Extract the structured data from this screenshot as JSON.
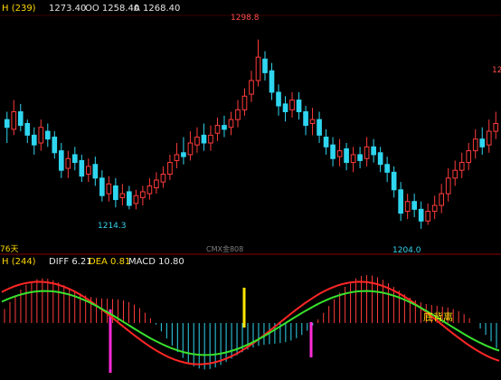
{
  "main_panel": {
    "header": {
      "title": "H (239)",
      "high_label": "1273.40",
      "open_label": "OO 1258.40",
      "avg_label": "A 1268.40"
    },
    "days_label": "76天",
    "watermark": "CMX金808",
    "price_annotations": [
      {
        "text": "1298.8",
        "color": "#ff4d4d"
      },
      {
        "text": "1214.3",
        "color": "#36d3ee"
      },
      {
        "text": "1204.0",
        "color": "#36d3ee"
      },
      {
        "text": "12",
        "color": "#ff4d4d"
      }
    ]
  },
  "macd_panel": {
    "header": {
      "title": "H (244)",
      "diff": "DIFF 6.21",
      "dea": "DEA 0.81",
      "macd": "MACD 10.80"
    },
    "annotation": "底背离"
  },
  "chart_data": {
    "type": "candlestick",
    "y_range": [
      1195,
      1310
    ],
    "candles": [
      [
        1258,
        1254,
        1262,
        1246
      ],
      [
        1253,
        1262,
        1268,
        1250
      ],
      [
        1262,
        1255,
        1266,
        1252
      ],
      [
        1256,
        1250,
        1258,
        1246
      ],
      [
        1250,
        1245,
        1254,
        1240
      ],
      [
        1246,
        1254,
        1258,
        1242
      ],
      [
        1252,
        1248,
        1256,
        1244
      ],
      [
        1249,
        1241,
        1252,
        1238
      ],
      [
        1242,
        1232,
        1246,
        1228
      ],
      [
        1233,
        1238,
        1242,
        1228
      ],
      [
        1240,
        1236,
        1244,
        1232
      ],
      [
        1237,
        1229,
        1240,
        1226
      ],
      [
        1230,
        1234,
        1238,
        1226
      ],
      [
        1235,
        1228,
        1239,
        1224
      ],
      [
        1228,
        1219,
        1232,
        1216
      ],
      [
        1220,
        1225,
        1229,
        1216
      ],
      [
        1224,
        1217,
        1228,
        1213
      ],
      [
        1218,
        1220,
        1225,
        1214
      ],
      [
        1221,
        1214,
        1224,
        1212
      ],
      [
        1215,
        1219,
        1222,
        1212
      ],
      [
        1218,
        1221,
        1224,
        1214
      ],
      [
        1220,
        1224,
        1228,
        1217
      ],
      [
        1223,
        1227,
        1231,
        1220
      ],
      [
        1226,
        1230,
        1234,
        1223
      ],
      [
        1230,
        1236,
        1240,
        1227
      ],
      [
        1237,
        1240,
        1246,
        1233
      ],
      [
        1241,
        1239,
        1249,
        1235
      ],
      [
        1240,
        1246,
        1252,
        1237
      ],
      [
        1245,
        1249,
        1254,
        1241
      ],
      [
        1250,
        1246,
        1256,
        1242
      ],
      [
        1246,
        1250,
        1255,
        1242
      ],
      [
        1251,
        1255,
        1259,
        1247
      ],
      [
        1255,
        1253,
        1260,
        1249
      ],
      [
        1254,
        1258,
        1262,
        1250
      ],
      [
        1258,
        1263,
        1268,
        1254
      ],
      [
        1263,
        1270,
        1274,
        1260
      ],
      [
        1271,
        1278,
        1283,
        1267
      ],
      [
        1278,
        1290,
        1299,
        1275
      ],
      [
        1289,
        1282,
        1293,
        1278
      ],
      [
        1283,
        1272,
        1287,
        1268
      ],
      [
        1272,
        1265,
        1276,
        1260
      ],
      [
        1266,
        1262,
        1270,
        1257
      ],
      [
        1263,
        1268,
        1272,
        1259
      ],
      [
        1268,
        1262,
        1272,
        1258
      ],
      [
        1262,
        1255,
        1265,
        1250
      ],
      [
        1256,
        1258,
        1264,
        1250
      ],
      [
        1258,
        1250,
        1262,
        1246
      ],
      [
        1249,
        1244,
        1253,
        1240
      ],
      [
        1245,
        1238,
        1249,
        1234
      ],
      [
        1239,
        1242,
        1248,
        1234
      ],
      [
        1243,
        1236,
        1246,
        1232
      ],
      [
        1236,
        1240,
        1244,
        1231
      ],
      [
        1240,
        1237,
        1244,
        1233
      ],
      [
        1238,
        1244,
        1249,
        1234
      ],
      [
        1244,
        1240,
        1248,
        1236
      ],
      [
        1241,
        1235,
        1244,
        1231
      ],
      [
        1235,
        1231,
        1239,
        1226
      ],
      [
        1231,
        1222,
        1234,
        1218
      ],
      [
        1222,
        1210,
        1226,
        1206
      ],
      [
        1211,
        1216,
        1220,
        1207
      ],
      [
        1216,
        1212,
        1220,
        1208
      ],
      [
        1212,
        1206,
        1216,
        1202
      ],
      [
        1206,
        1211,
        1215,
        1204
      ],
      [
        1211,
        1214,
        1219,
        1207
      ],
      [
        1214,
        1220,
        1225,
        1210
      ],
      [
        1220,
        1228,
        1233,
        1216
      ],
      [
        1228,
        1232,
        1237,
        1224
      ],
      [
        1232,
        1236,
        1241,
        1228
      ],
      [
        1236,
        1242,
        1246,
        1232
      ],
      [
        1242,
        1248,
        1253,
        1238
      ],
      [
        1248,
        1244,
        1254,
        1240
      ],
      [
        1245,
        1252,
        1258,
        1241
      ],
      [
        1252,
        1256,
        1262,
        1248
      ]
    ],
    "macd_lines": {
      "diff_color": "#ff2626",
      "dea_color": "#39e12d"
    }
  }
}
